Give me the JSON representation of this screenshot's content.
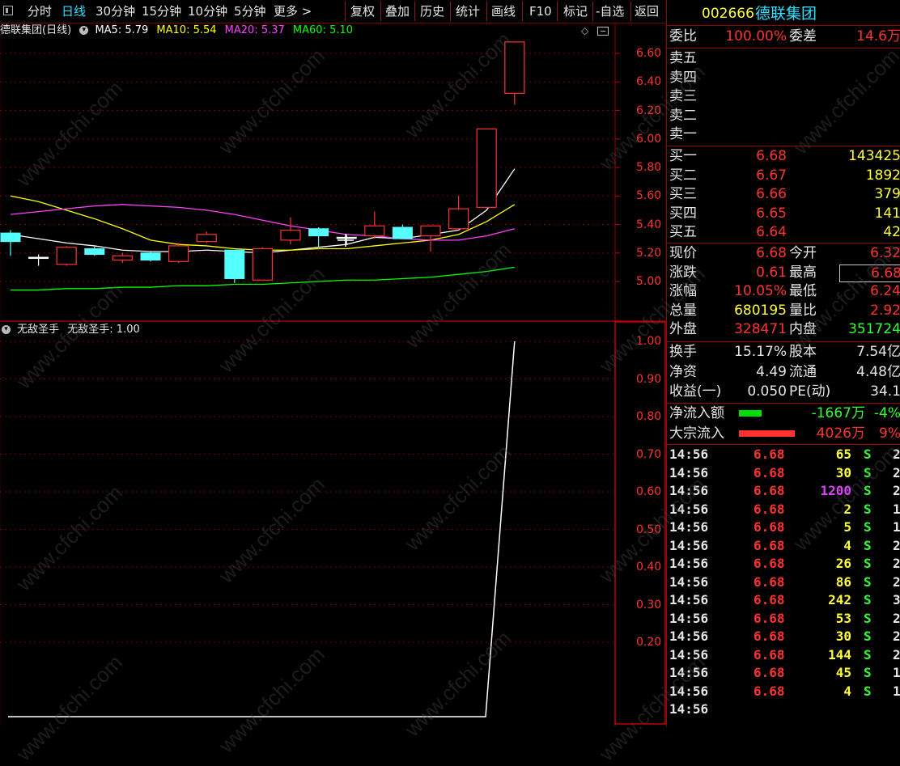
{
  "toolbar": {
    "items": [
      "分时",
      "日线",
      "30分钟",
      "15分钟",
      "10分钟",
      "5分钟",
      "更多 >"
    ],
    "active_index": 1,
    "actions": [
      "复权",
      "叠加",
      "历史",
      "统计",
      "画线",
      "F10",
      "标记",
      "-自选",
      "返回"
    ]
  },
  "main_chart": {
    "title": "德联集团(日线)",
    "ma": [
      {
        "label": "MA5: 5.79",
        "color": "#ffffff"
      },
      {
        "label": "MA10: 5.54",
        "color": "#ffff00"
      },
      {
        "label": "MA20: 5.37",
        "color": "#ff40ff"
      },
      {
        "label": "MA60: 5.10",
        "color": "#00ff00"
      }
    ],
    "price_ticks": [
      "6.60",
      "6.40",
      "6.20",
      "6.00",
      "5.80",
      "5.60",
      "5.40",
      "5.20",
      "5.00"
    ]
  },
  "indicator": {
    "title": "无敌圣手",
    "value_label": "无敌圣手: 1.00",
    "ticks": [
      "1.00",
      "0.90",
      "0.80",
      "0.70",
      "0.60",
      "0.50",
      "0.40",
      "0.30",
      "0.20"
    ]
  },
  "chart_data": {
    "type": "candlestick",
    "ylim": [
      4.95,
      6.72
    ],
    "candles": [
      {
        "o": 5.34,
        "c": 5.28,
        "h": 5.36,
        "l": 5.18
      },
      {
        "o": 5.17,
        "c": 5.17,
        "h": 5.19,
        "l": 5.11
      },
      {
        "o": 5.12,
        "c": 5.24,
        "h": 5.25,
        "l": 5.11
      },
      {
        "o": 5.23,
        "c": 5.19,
        "h": 5.25,
        "l": 5.18
      },
      {
        "o": 5.15,
        "c": 5.18,
        "h": 5.2,
        "l": 5.13
      },
      {
        "o": 5.2,
        "c": 5.15,
        "h": 5.21,
        "l": 5.14
      },
      {
        "o": 5.14,
        "c": 5.25,
        "h": 5.27,
        "l": 5.13
      },
      {
        "o": 5.28,
        "c": 5.33,
        "h": 5.35,
        "l": 5.27
      },
      {
        "o": 5.22,
        "c": 5.02,
        "h": 5.22,
        "l": 4.99
      },
      {
        "o": 5.01,
        "c": 5.23,
        "h": 5.24,
        "l": 5.01
      },
      {
        "o": 5.29,
        "c": 5.36,
        "h": 5.45,
        "l": 5.26
      },
      {
        "o": 5.37,
        "c": 5.32,
        "h": 5.38,
        "l": 5.24
      },
      {
        "o": 5.31,
        "c": 5.31,
        "h": 5.33,
        "l": 5.26
      },
      {
        "o": 5.32,
        "c": 5.39,
        "h": 5.49,
        "l": 5.3
      },
      {
        "o": 5.38,
        "c": 5.3,
        "h": 5.4,
        "l": 5.3
      },
      {
        "o": 5.32,
        "c": 5.39,
        "h": 5.39,
        "l": 5.21
      },
      {
        "o": 5.37,
        "c": 5.51,
        "h": 5.6,
        "l": 5.37
      },
      {
        "o": 5.52,
        "c": 6.07,
        "h": 6.07,
        "l": 5.52
      },
      {
        "o": 6.32,
        "c": 6.68,
        "h": 6.68,
        "l": 6.24
      }
    ],
    "ma_series": [
      {
        "name": "MA5",
        "color": "#ffffff",
        "values": [
          5.33,
          5.3,
          5.27,
          5.25,
          5.22,
          5.21,
          5.21,
          5.22,
          5.21,
          5.2,
          5.22,
          5.24,
          5.26,
          5.31,
          5.3,
          5.33,
          5.36,
          5.5,
          5.79
        ]
      },
      {
        "name": "MA10",
        "color": "#ffff00",
        "values": [
          5.6,
          5.56,
          5.5,
          5.44,
          5.37,
          5.29,
          5.26,
          5.25,
          5.23,
          5.22,
          5.22,
          5.23,
          5.23,
          5.25,
          5.27,
          5.29,
          5.33,
          5.42,
          5.54
        ]
      },
      {
        "name": "MA20",
        "color": "#ff40ff",
        "values": [
          5.47,
          5.49,
          5.51,
          5.53,
          5.54,
          5.53,
          5.52,
          5.5,
          5.47,
          5.43,
          5.39,
          5.36,
          5.33,
          5.32,
          5.3,
          5.29,
          5.29,
          5.32,
          5.37
        ]
      },
      {
        "name": "MA60",
        "color": "#00ff00",
        "values": [
          4.94,
          4.94,
          4.95,
          4.95,
          4.96,
          4.96,
          4.97,
          4.97,
          4.98,
          4.98,
          4.99,
          5.0,
          5.01,
          5.01,
          5.02,
          5.03,
          5.05,
          5.07,
          5.1
        ]
      }
    ],
    "indicator_series": {
      "name": "无敌圣手",
      "values": [
        0,
        0,
        0,
        0,
        0,
        0,
        0,
        0,
        0,
        0,
        0,
        0,
        0,
        0,
        0,
        0,
        0,
        0,
        1
      ],
      "ylim": [
        0.0,
        1.0
      ]
    }
  },
  "quote": {
    "code": "002666",
    "name": "德联集团",
    "weibi_label": "委比",
    "weibi_value": "100.00%",
    "weicha_label": "委差",
    "weicha_value": "14.6万",
    "sell": [
      {
        "label": "卖五",
        "price": "",
        "vol": ""
      },
      {
        "label": "卖四",
        "price": "",
        "vol": ""
      },
      {
        "label": "卖三",
        "price": "",
        "vol": ""
      },
      {
        "label": "卖二",
        "price": "",
        "vol": ""
      },
      {
        "label": "卖一",
        "price": "",
        "vol": ""
      }
    ],
    "buy": [
      {
        "label": "买一",
        "price": "6.68",
        "vol": "143425"
      },
      {
        "label": "买二",
        "price": "6.67",
        "vol": "1892"
      },
      {
        "label": "买三",
        "price": "6.66",
        "vol": "379"
      },
      {
        "label": "买四",
        "price": "6.65",
        "vol": "141"
      },
      {
        "label": "买五",
        "price": "6.64",
        "vol": "42"
      }
    ],
    "stats": [
      {
        "l1": "现价",
        "v1": "6.68",
        "c1": "red",
        "l2": "今开",
        "v2": "6.32",
        "c2": "red"
      },
      {
        "l1": "涨跌",
        "v1": "0.61",
        "c1": "red",
        "l2": "最高",
        "v2": "6.68",
        "c2": "red"
      },
      {
        "l1": "涨幅",
        "v1": "10.05%",
        "c1": "red",
        "l2": "最低",
        "v2": "6.24",
        "c2": "red"
      },
      {
        "l1": "总量",
        "v1": "680195",
        "c1": "yellow",
        "l2": "量比",
        "v2": "2.92",
        "c2": "red"
      },
      {
        "l1": "外盘",
        "v1": "328471",
        "c1": "red",
        "l2": "内盘",
        "v2": "351724",
        "c2": "green"
      }
    ],
    "stats2": [
      {
        "l1": "换手",
        "v1": "15.17%",
        "l2": "股本",
        "v2": "7.54亿"
      },
      {
        "l1": "净资",
        "v1": "4.49",
        "l2": "流通",
        "v2": "4.48亿"
      },
      {
        "l1": "收益(一)",
        "v1": "0.050",
        "l2": "PE(动)",
        "v2": "34.1"
      }
    ],
    "flows": [
      {
        "label": "净流入额",
        "bar_color": "#00e000",
        "bar_width": 0.31,
        "value": "-1667万",
        "pct": "-4%",
        "color": "green"
      },
      {
        "label": "大宗流入",
        "bar_color": "#ff3232",
        "bar_width": 0.77,
        "value": "4026万",
        "pct": "9%",
        "color": "red"
      }
    ]
  },
  "ticks": [
    {
      "time": "14:56",
      "price": "6.68",
      "vol": "65",
      "vcolor": "yellow",
      "side": "S",
      "n": "2"
    },
    {
      "time": "14:56",
      "price": "6.68",
      "vol": "30",
      "vcolor": "yellow",
      "side": "S",
      "n": "2"
    },
    {
      "time": "14:56",
      "price": "6.68",
      "vol": "1200",
      "vcolor": "magenta",
      "side": "S",
      "n": "2"
    },
    {
      "time": "14:56",
      "price": "6.68",
      "vol": "2",
      "vcolor": "yellow",
      "side": "S",
      "n": "1"
    },
    {
      "time": "14:56",
      "price": "6.68",
      "vol": "5",
      "vcolor": "yellow",
      "side": "S",
      "n": "1"
    },
    {
      "time": "14:56",
      "price": "6.68",
      "vol": "4",
      "vcolor": "yellow",
      "side": "S",
      "n": "2"
    },
    {
      "time": "14:56",
      "price": "6.68",
      "vol": "26",
      "vcolor": "yellow",
      "side": "S",
      "n": "2"
    },
    {
      "time": "14:56",
      "price": "6.68",
      "vol": "86",
      "vcolor": "yellow",
      "side": "S",
      "n": "2"
    },
    {
      "time": "14:56",
      "price": "6.68",
      "vol": "242",
      "vcolor": "yellow",
      "side": "S",
      "n": "3"
    },
    {
      "time": "14:56",
      "price": "6.68",
      "vol": "53",
      "vcolor": "yellow",
      "side": "S",
      "n": "2"
    },
    {
      "time": "14:56",
      "price": "6.68",
      "vol": "30",
      "vcolor": "yellow",
      "side": "S",
      "n": "2"
    },
    {
      "time": "14:56",
      "price": "6.68",
      "vol": "144",
      "vcolor": "yellow",
      "side": "S",
      "n": "2"
    },
    {
      "time": "14:56",
      "price": "6.68",
      "vol": "45",
      "vcolor": "yellow",
      "side": "S",
      "n": "1"
    },
    {
      "time": "14:56",
      "price": "6.68",
      "vol": "4",
      "vcolor": "yellow",
      "side": "S",
      "n": "1"
    },
    {
      "time": "14:56",
      "price": "",
      "vol": "",
      "vcolor": "yellow",
      "side": "",
      "n": ""
    }
  ],
  "watermark": "www.cfchi.com"
}
